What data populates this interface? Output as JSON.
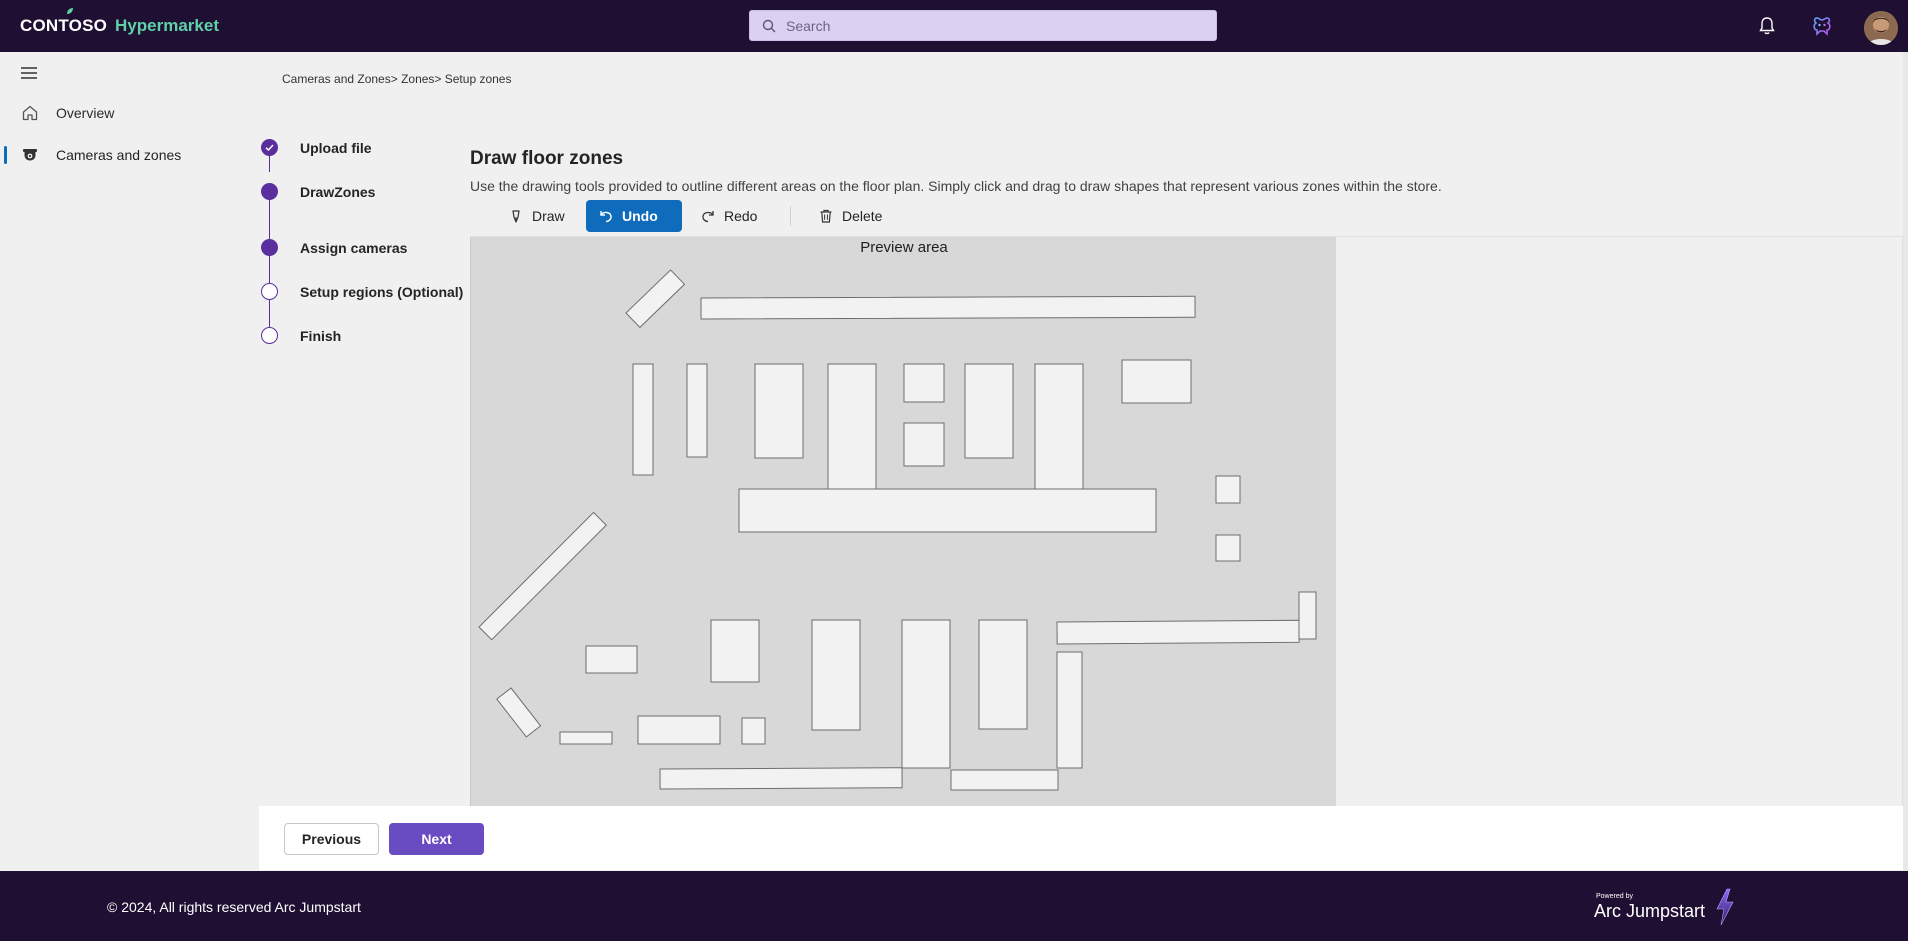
{
  "header": {
    "brand_primary": "CONTOSO",
    "brand_secondary": "Hypermarket",
    "search_placeholder": "Search"
  },
  "sidenav": {
    "items": [
      {
        "label": "Overview",
        "icon": "home-icon",
        "active": false
      },
      {
        "label": "Cameras and zones",
        "icon": "camera-icon",
        "active": true
      }
    ]
  },
  "breadcrumb": "Cameras and Zones> Zones> Setup zones",
  "stepper": {
    "steps": [
      {
        "label": "Upload file",
        "state": "done"
      },
      {
        "label": "DrawZones",
        "state": "current"
      },
      {
        "label": "Assign cameras",
        "state": "current"
      },
      {
        "label": "Setup regions (Optional)",
        "state": "pending"
      },
      {
        "label": "Finish",
        "state": "pending"
      }
    ]
  },
  "main": {
    "title": "Draw floor zones",
    "description": "Use the drawing tools provided to outline different areas on the floor plan. Simply click and drag to draw shapes that represent various zones within the store.",
    "toolbar": {
      "draw": "Draw",
      "undo": "Undo",
      "redo": "Redo",
      "delete": "Delete"
    },
    "preview_title": "Preview area"
  },
  "actions": {
    "previous": "Previous",
    "next": "Next"
  },
  "footer": {
    "copyright": "© 2024, All rights reserved Arc Jumpstart",
    "powered_by": "Powered by",
    "product": "Arc Jumpstart"
  },
  "colors": {
    "topbar": "#1f0f32",
    "accent": "#5b2e9e",
    "primary_button": "#0f6cbd",
    "next_button": "#6a4cc2",
    "brand_green": "#5fd0a8"
  }
}
